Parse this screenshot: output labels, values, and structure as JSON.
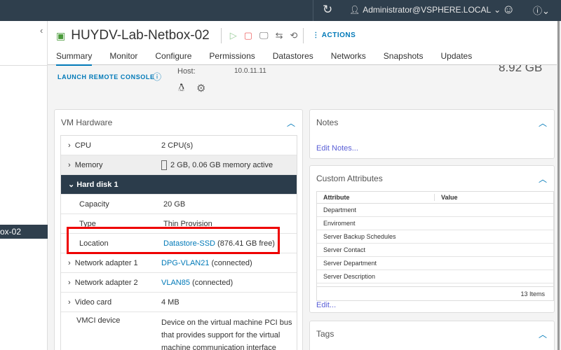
{
  "header": {
    "user": "Administrator@VSPHERE.LOCAL",
    "refresh_icon": "refresh-icon",
    "feedback_icon": "smiley-icon",
    "help_icon": "help-icon"
  },
  "sidebar": {
    "selected_item": "ox-02"
  },
  "vm": {
    "name": "HUYDV-Lab-Netbox-02",
    "actions_label": "ACTIONS"
  },
  "tabs": [
    "Summary",
    "Monitor",
    "Configure",
    "Permissions",
    "Datastores",
    "Networks",
    "Snapshots",
    "Updates"
  ],
  "summary": {
    "launch_remote_console": "LAUNCH REMOTE CONSOLE",
    "host_label": "Host:",
    "host_value": "10.0.11.11",
    "memory_value": "8.92 GB"
  },
  "vm_hardware": {
    "title": "VM Hardware",
    "rows": [
      {
        "key": "CPU",
        "value": "2 CPU(s)"
      },
      {
        "key": "Memory",
        "value": "2 GB, 0.06 GB memory active"
      },
      {
        "key": "Hard disk 1",
        "value": ""
      },
      {
        "key": "Capacity",
        "value": "20 GB"
      },
      {
        "key": "Type",
        "value": "Thin Provision"
      },
      {
        "key": "Location",
        "link": "Datastore-SSD",
        "value": " (876.41 GB free)"
      },
      {
        "key": "Network adapter 1",
        "link": "DPG-VLAN21",
        "value": " (connected)"
      },
      {
        "key": "Network adapter 2",
        "link": "VLAN85",
        "value": " (connected)"
      },
      {
        "key": "Video card",
        "value": "4 MB"
      },
      {
        "key": "VMCI device",
        "value": "Device on the virtual machine PCI bus that provides support for the virtual machine communication interface"
      }
    ]
  },
  "notes": {
    "title": "Notes",
    "edit": "Edit Notes..."
  },
  "custom_attributes": {
    "title": "Custom Attributes",
    "columns": [
      "Attribute",
      "Value"
    ],
    "rows": [
      "Department",
      "Enviroment",
      "Server Backup Schedules",
      "Server Contact",
      "Server Department",
      "Server Description"
    ],
    "count": "13 Items",
    "edit": "Edit..."
  },
  "tags": {
    "title": "Tags"
  }
}
